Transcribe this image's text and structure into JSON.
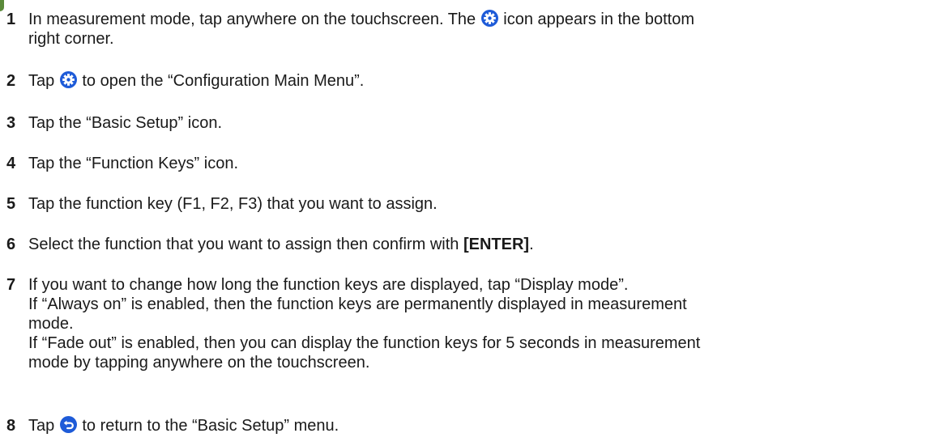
{
  "steps": [
    {
      "number": "1",
      "lines": [
        {
          "before": "In measurement mode, tap anywhere on the touchscreen. The ",
          "icon": "gear-icon",
          "after": " icon appears in the bottom"
        },
        {
          "text": "right corner."
        }
      ]
    },
    {
      "number": "2",
      "lines": [
        {
          "before": "Tap ",
          "icon": "gear-icon",
          "after": " to open the “Configuration Main Menu”."
        }
      ]
    },
    {
      "number": "3",
      "lines": [
        {
          "text": "Tap the “Basic Setup” icon."
        }
      ]
    },
    {
      "number": "4",
      "lines": [
        {
          "text": "Tap the “Function Keys” icon."
        }
      ]
    },
    {
      "number": "5",
      "lines": [
        {
          "text": "Tap the function key (F1, F2, F3) that you want to assign."
        }
      ]
    },
    {
      "number": "6",
      "lines": [
        {
          "before": "Select the function that you want to assign then confirm with ",
          "bold": "[ENTER]",
          "after": "."
        }
      ]
    },
    {
      "number": "7",
      "lines": [
        {
          "text": "If you want to change how long the function keys are displayed, tap “Display mode”."
        },
        {
          "text": "If “Always on” is enabled, then the function keys are permanently displayed in measurement"
        },
        {
          "text": "mode."
        },
        {
          "text": "If “Fade out” is enabled, then you can display the function keys for 5 seconds in measurement"
        },
        {
          "text": "mode by tapping anywhere on the touchscreen."
        }
      ]
    },
    {
      "number": "8",
      "lines": [
        {
          "before": "Tap ",
          "icon": "back-icon",
          "after": " to return to the “Basic Setup” menu."
        }
      ]
    }
  ],
  "colors": {
    "icon_blue": "#1e5bd8",
    "text": "#1a1a1a"
  }
}
